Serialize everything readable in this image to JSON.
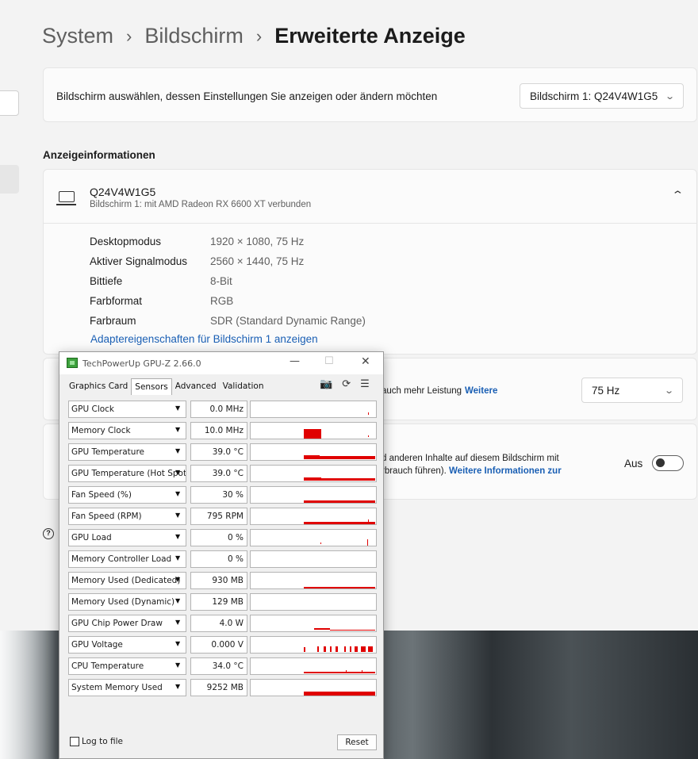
{
  "breadcrumb": {
    "item1": "System",
    "item2": "Bildschirm",
    "current": "Erweiterte Anzeige",
    "separator": "›"
  },
  "select_card": {
    "text": "Bildschirm auswählen, dessen Einstellungen Sie anzeigen oder ändern möchten",
    "dropdown_value": "Bildschirm 1: Q24V4W1G5",
    "chevron": "⌄"
  },
  "section_heading": "Anzeigeinformationen",
  "monitor": {
    "name": "Q24V4W1G5",
    "subtitle": "Bildschirm 1: mit AMD Radeon RX 6600 XT verbunden",
    "collapse_chevron": "⌃",
    "rows": [
      {
        "key": "Desktopmodus",
        "value": "1920 × 1080, 75 Hz"
      },
      {
        "key": "Aktiver Signalmodus",
        "value": "2560 × 1440, 75 Hz"
      },
      {
        "key": "Bittiefe",
        "value": "8-Bit"
      },
      {
        "key": "Farbformat",
        "value": "RGB"
      },
      {
        "key": "Farbraum",
        "value": "SDR (Standard Dynamic Range)"
      }
    ],
    "adapter_link": "Adaptereigenschaften für Bildschirm 1 anzeigen"
  },
  "refresh_card": {
    "desc_partial": "auch mehr Leistung",
    "link": "Weitere",
    "dropdown_value": "75 Hz",
    "chevron": "⌄"
  },
  "hdr_card": {
    "desc_line1": "d anderen Inhalte auf diesem Bildschirm mit",
    "desc_line2": "rbrauch führen).",
    "link": "Weitere Informationen zur",
    "toggle_label": "Aus"
  },
  "help_icon_glyph": "?",
  "gpuz": {
    "title": "TechPowerUp GPU-Z 2.66.0",
    "window_buttons": {
      "min": "—",
      "max": "☐",
      "close": "✕"
    },
    "tabs": [
      "Graphics Card",
      "Sensors",
      "Advanced",
      "Validation"
    ],
    "tool_icons": {
      "camera": "📷",
      "refresh": "⟳",
      "menu": "☰"
    },
    "sensors": [
      {
        "name": "GPU Clock",
        "value": "0.0 MHz"
      },
      {
        "name": "Memory Clock",
        "value": "10.0 MHz"
      },
      {
        "name": "GPU Temperature",
        "value": "39.0 °C"
      },
      {
        "name": "GPU Temperature (Hot Spot)",
        "value": "39.0 °C"
      },
      {
        "name": "Fan Speed (%)",
        "value": "30 %"
      },
      {
        "name": "Fan Speed (RPM)",
        "value": "795 RPM"
      },
      {
        "name": "GPU Load",
        "value": "0 %"
      },
      {
        "name": "Memory Controller Load",
        "value": "0 %"
      },
      {
        "name": "Memory Used (Dedicated)",
        "value": "930 MB"
      },
      {
        "name": "Memory Used (Dynamic)",
        "value": "129 MB"
      },
      {
        "name": "GPU Chip Power Draw",
        "value": "4.0 W"
      },
      {
        "name": "GPU Voltage",
        "value": "0.000 V"
      },
      {
        "name": "CPU Temperature",
        "value": "34.0 °C"
      },
      {
        "name": "System Memory Used",
        "value": "9252 MB"
      }
    ],
    "dropdown_arrow": "▼",
    "log_label": "Log to file",
    "reset_label": "Reset"
  },
  "colors": {
    "accent_link": "#1a5fb4",
    "graph_red": "#e00000"
  }
}
